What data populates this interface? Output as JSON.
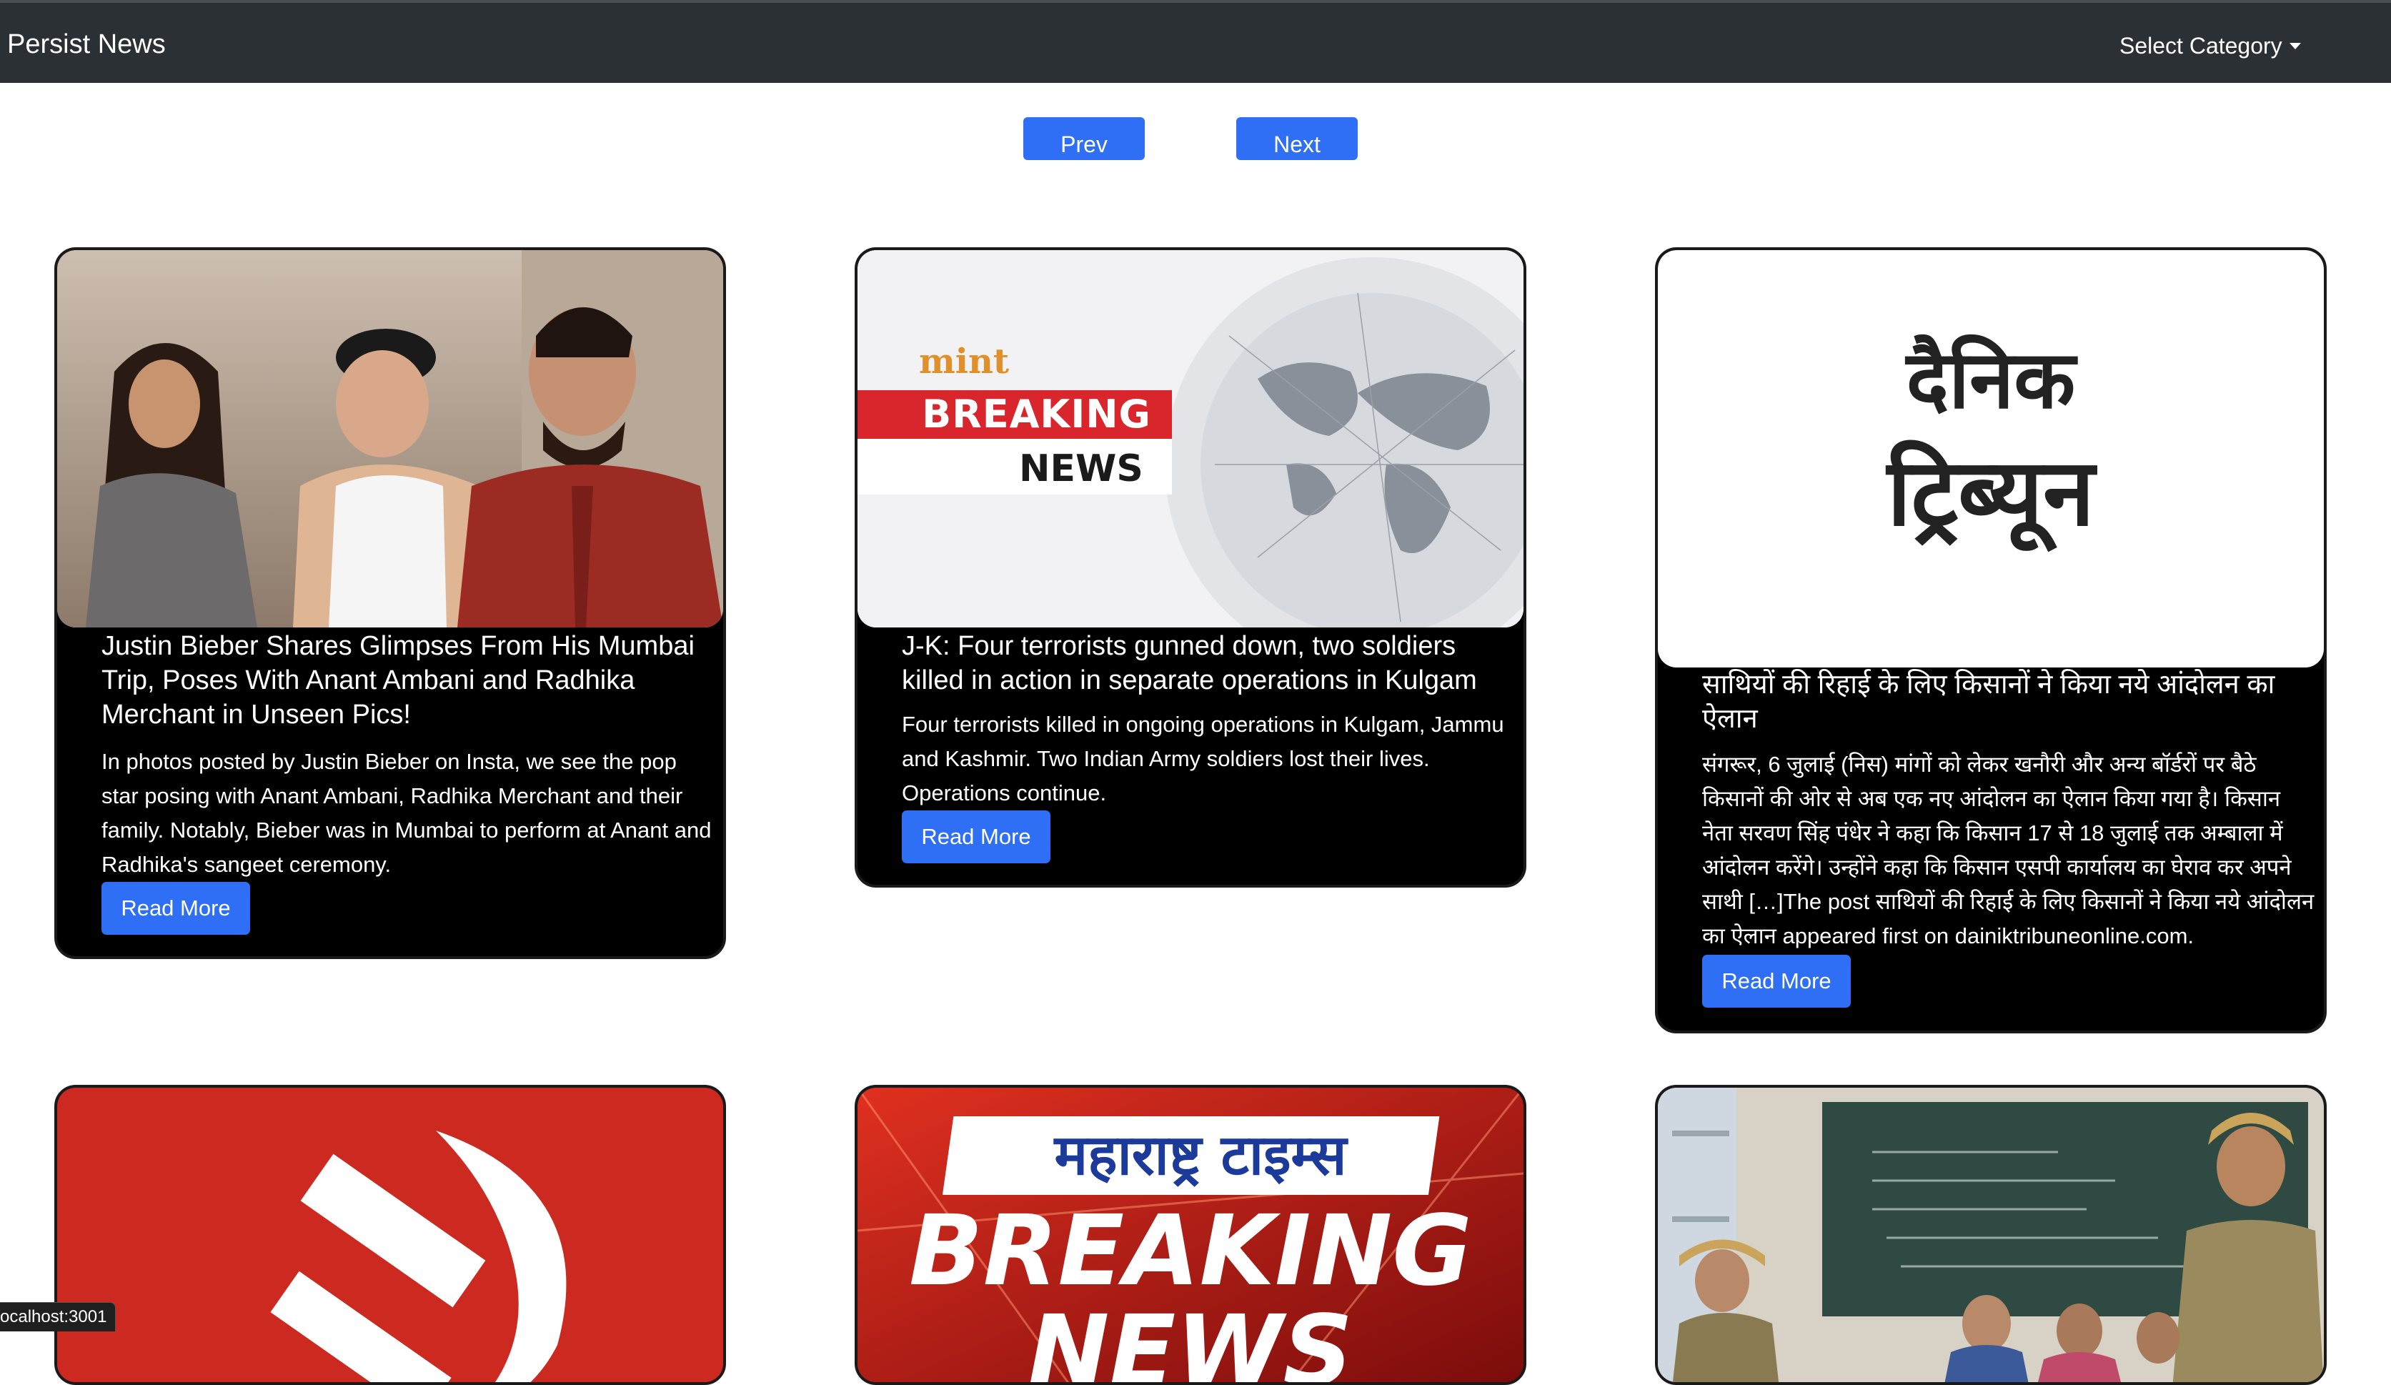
{
  "navbar": {
    "brand": "Persist News",
    "category_label": "Select Category",
    "category_icon": "caret-down-icon"
  },
  "pager": {
    "prev_label": "Prev",
    "next_label": "Next"
  },
  "colors": {
    "navbar_bg": "#2b3035",
    "accent": "#2f6ff5",
    "card_bg": "#000000"
  },
  "cards": [
    {
      "title": "Justin Bieber Shares Glimpses From His Mumbai Trip, Poses With Anant Ambani and Radhika Merchant in Unseen Pics!",
      "description": "In photos posted by Justin Bieber on Insta, we see the pop star posing with Anant Ambani, Radhika Merchant and their family. Notably, Bieber was in Mumbai to perform at Anant and Radhika's sangeet ceremony.",
      "button": "Read More",
      "image": "photo-three-people-icon"
    },
    {
      "title": "J-K: Four terrorists gunned down, two soldiers killed in action in separate operations in Kulgam",
      "description": "Four terrorists killed in ongoing operations in Kulgam, Jammu and Kashmir. Two Indian Army soldiers lost their lives. Operations continue.",
      "button": "Read More",
      "image": "mint-breaking-news-icon",
      "image_text": {
        "logo": "mint",
        "line1": "BREAKING",
        "line2": "NEWS"
      }
    },
    {
      "title": "साथियों की रिहाई के लिए किसानों ने किया नये आंदोलन का ऐलान",
      "description": "संगरूर, 6 जुलाई (निस) मांगों को लेकर खनौरी और अन्य बॉर्डरों पर बैठे किसानों की ओर से अब एक नए आंदोलन का ऐलान किया गया है। किसान नेता सरवण सिंह पंधेर ने कहा कि किसान 17 से 18 जुलाई तक अम्बाला में आंदोलन करेंगे। उन्होंने कहा कि किसान एसपी कार्यालय का घेराव कर अपने साथी […]The post साथियों की रिहाई के लिए किसानों ने किया नये आंदोलन का ऐलान appeared first on dainiktribuneonline.com.",
      "button": "Read More",
      "image": "dainik-tribune-logo-icon",
      "image_text": {
        "line1": "दैनिक",
        "line2": "ट्रिब्यून"
      }
    },
    {
      "image": "hammer-sickle-icon"
    },
    {
      "image": "maharashtra-times-breaking-news-icon",
      "image_text": {
        "line1": "महाराष्ट्र टाइम्स",
        "line2": "BREAKING",
        "line3": "NEWS"
      }
    },
    {
      "image": "classroom-police-photo-icon"
    }
  ],
  "status_bar": {
    "url": "ocalhost:3001"
  }
}
